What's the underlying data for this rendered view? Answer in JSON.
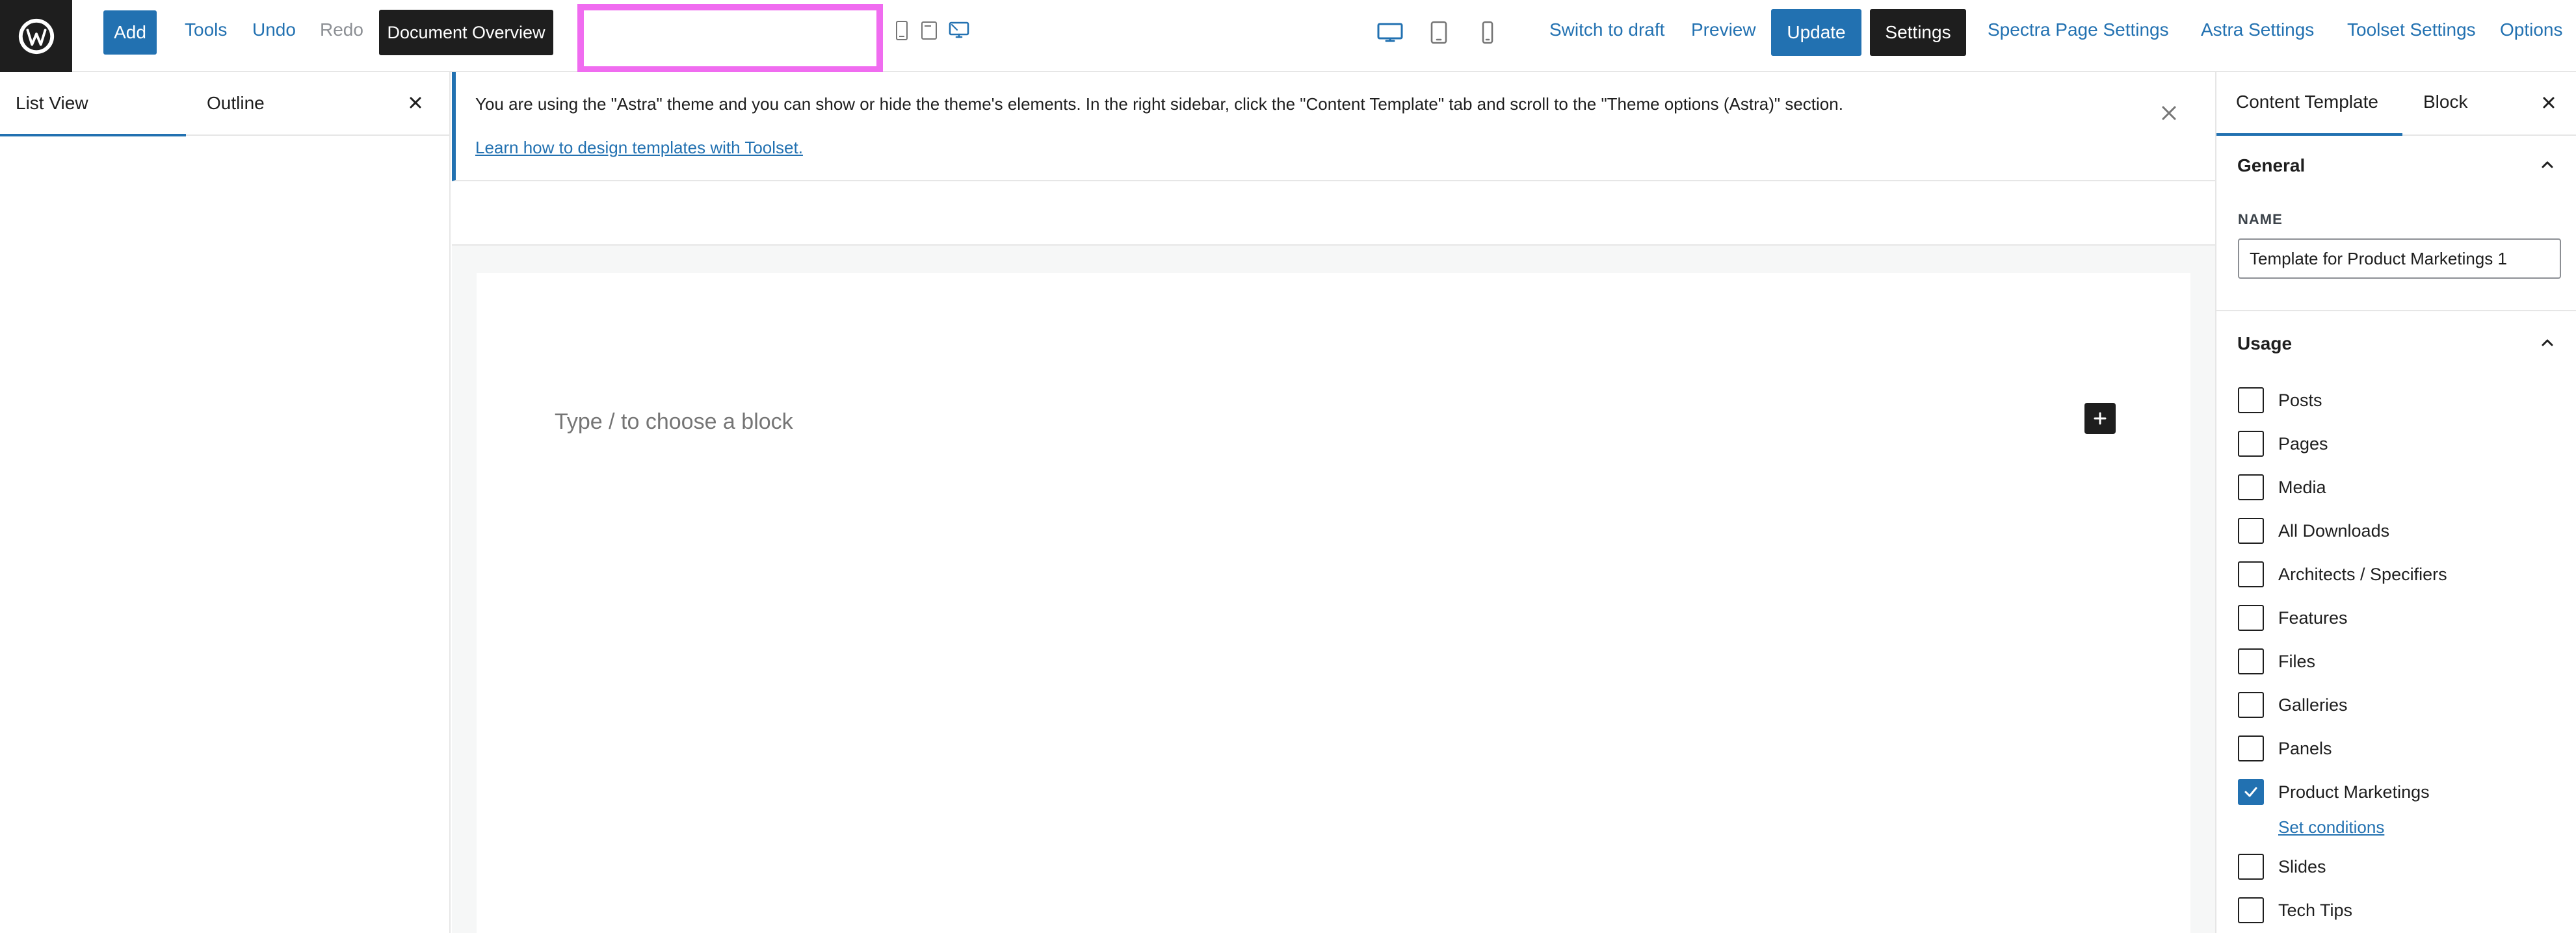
{
  "topbar": {
    "add_label": "Add",
    "tools_label": "Tools",
    "undo_label": "Undo",
    "redo_label": "Redo",
    "document_overview_label": "Document Overview",
    "switch_to_draft_label": "Switch to draft",
    "preview_label": "Preview",
    "update_label": "Update",
    "settings_label": "Settings",
    "spectra_label": "Spectra Page Settings",
    "astra_label": "Astra Settings",
    "toolset_label": "Toolset Settings",
    "options_label": "Options"
  },
  "left_panel": {
    "tab_list_view": "List View",
    "tab_outline": "Outline"
  },
  "notice": {
    "message": "You are using the \"Astra\" theme and you can show or hide the theme's elements. In the right sidebar, click the \"Content Template\" tab and scroll to the \"Theme options (Astra)\" section.",
    "link": "Learn how to design templates with Toolset."
  },
  "editor": {
    "placeholder": "Type / to choose a block"
  },
  "right_panel": {
    "tab_content_template": "Content Template",
    "tab_block": "Block",
    "general_title": "General",
    "name_label": "NAME",
    "name_value": "Template for Product Marketings 1",
    "usage_title": "Usage",
    "usage_items": [
      {
        "label": "Posts",
        "checked": false
      },
      {
        "label": "Pages",
        "checked": false
      },
      {
        "label": "Media",
        "checked": false
      },
      {
        "label": "All Downloads",
        "checked": false
      },
      {
        "label": "Architects / Specifiers",
        "checked": false
      },
      {
        "label": "Features",
        "checked": false
      },
      {
        "label": "Files",
        "checked": false
      },
      {
        "label": "Galleries",
        "checked": false
      },
      {
        "label": "Panels",
        "checked": false
      },
      {
        "label": "Product Marketings",
        "checked": true
      },
      {
        "label": "Slides",
        "checked": false
      },
      {
        "label": "Tech Tips",
        "checked": false
      }
    ],
    "set_conditions_label": "Set conditions"
  },
  "colors": {
    "accent": "#2271b1",
    "dark": "#1e1e1e",
    "highlight_box": "#f06cf0"
  }
}
